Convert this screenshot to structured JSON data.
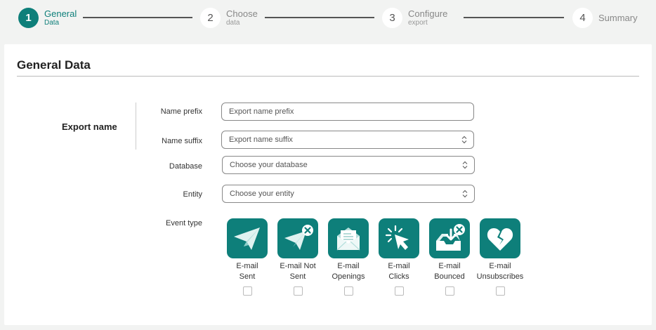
{
  "stepper": {
    "steps": [
      {
        "number": "1",
        "title": "General",
        "subtitle": "Data"
      },
      {
        "number": "2",
        "title": "Choose",
        "subtitle": "data"
      },
      {
        "number": "3",
        "title": "Configure",
        "subtitle": "export"
      },
      {
        "number": "4",
        "title": "Summary",
        "subtitle": ""
      }
    ],
    "active_step": 1
  },
  "card": {
    "title": "General Data",
    "section_label": "Export name"
  },
  "form": {
    "name_prefix": {
      "label": "Name prefix",
      "placeholder": "Export name prefix"
    },
    "name_suffix": {
      "label": "Name suffix",
      "placeholder": "Export name suffix"
    },
    "database": {
      "label": "Database",
      "placeholder": "Choose your database"
    },
    "entity": {
      "label": "Entity",
      "placeholder": "Choose your entity"
    },
    "event_type_label": "Event type"
  },
  "event_types": [
    {
      "label_line1": "E-mail",
      "label_line2": "Sent",
      "icon": "paper-plane-icon",
      "checked": false
    },
    {
      "label_line1": "E-mail Not",
      "label_line2": "Sent",
      "icon": "paper-plane-x-icon",
      "checked": false
    },
    {
      "label_line1": "E-mail",
      "label_line2": "Openings",
      "icon": "open-envelope-icon",
      "checked": false
    },
    {
      "label_line1": "E-mail",
      "label_line2": "Clicks",
      "icon": "cursor-click-icon",
      "checked": false
    },
    {
      "label_line1": "E-mail",
      "label_line2": "Bounced",
      "icon": "inbox-x-icon",
      "checked": false
    },
    {
      "label_line1": "E-mail",
      "label_line2": "Unsubscribes",
      "icon": "broken-heart-icon",
      "checked": false
    }
  ],
  "colors": {
    "accent": "#0e7f7a",
    "background": "#f2f3f2",
    "card": "#ffffff"
  }
}
